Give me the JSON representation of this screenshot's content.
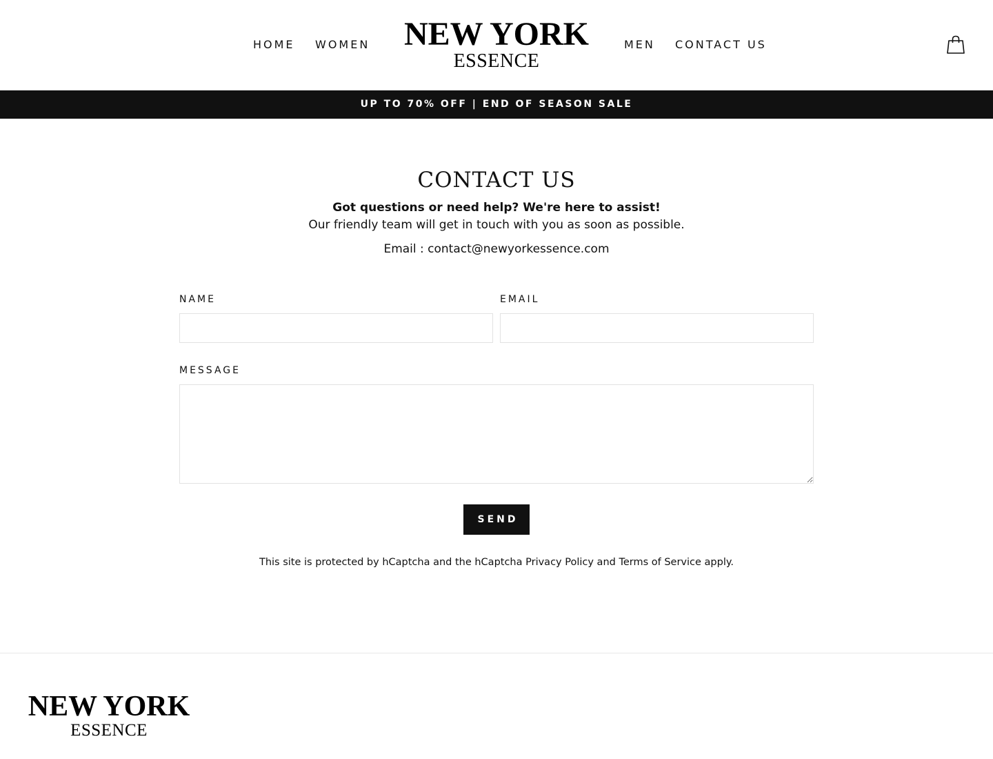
{
  "brand": {
    "logo_line1": "NEW YORK",
    "logo_line2": "ESSENCE"
  },
  "nav": {
    "left": [
      {
        "label": "HOME"
      },
      {
        "label": "WOMEN"
      }
    ],
    "right": [
      {
        "label": "MEN"
      },
      {
        "label": "CONTACT US"
      }
    ],
    "cart_icon": "shopping-bag-icon"
  },
  "announcement": {
    "text": "UP TO 70% OFF | END OF SEASON SALE",
    "background": "#111111",
    "color": "#ffffff"
  },
  "contact": {
    "title": "CONTACT US",
    "intro_bold": "Got questions or need help? We're here to assist!",
    "intro_text": "Our friendly team will get in touch with you as soon as possible.",
    "email_line": "Email : contact@newyorkessence.com"
  },
  "form": {
    "name_label": "NAME",
    "name_value": "",
    "email_label": "EMAIL",
    "email_value": "",
    "message_label": "MESSAGE",
    "message_value": "",
    "send_label": "SEND"
  },
  "captcha_note": {
    "prefix": "This site is protected by hCaptcha and the hCaptcha ",
    "privacy_link": "Privacy Policy",
    "middle": " and ",
    "terms_link": "Terms of Service",
    "suffix": " apply."
  },
  "footer": {
    "logo_line1": "NEW YORK",
    "logo_line2": "ESSENCE"
  }
}
